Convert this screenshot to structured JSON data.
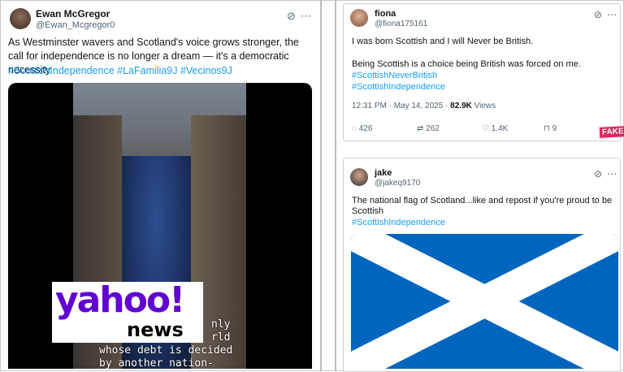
{
  "left_tweet": {
    "name": "Ewan McGregor",
    "handle": "@Ewan_Mcgregor0",
    "text": "As Westminster wavers and Scotland's voice grows stronger, the call for independence is no longer a dream — it's a democratic necessity.",
    "hashtags": "#ScottishIndependence #LaFamilia9J #Vecinos9J",
    "media": {
      "logo_top": "yahoo!",
      "logo_bottom": "news",
      "caption_lines": [
        "nly",
        "rld",
        "whose debt is decided",
        "by another nation-"
      ]
    }
  },
  "fiona_tweet": {
    "name": "fiona",
    "handle": "@fiona175161",
    "line1": "I was born Scottish and I will Never be British.",
    "line2": "Being Scottish is a choice being British was forced on me.",
    "tag1": "#ScottishNeverBritish",
    "tag2": "#ScottishIndependence",
    "timestamp": "12:31 PM · May 14, 2025 · ",
    "views_count": "82.9K",
    "views_label": " Views",
    "replies": "426",
    "reposts": "262",
    "likes": "1.4K",
    "bookmarks": "9",
    "fake_label": "FAKE"
  },
  "jake_tweet": {
    "name": "jake",
    "handle": "@jakeq9170",
    "line1": "The national flag of Scotland...like and repost if you're proud to be",
    "line2": "Scottish",
    "tag": "#ScottishIndependence"
  },
  "colors": {
    "link": "#1d9bf0",
    "flag_blue": "#0065bd",
    "yahoo_purple": "#6001d2",
    "fake_red": "#e0245e"
  }
}
